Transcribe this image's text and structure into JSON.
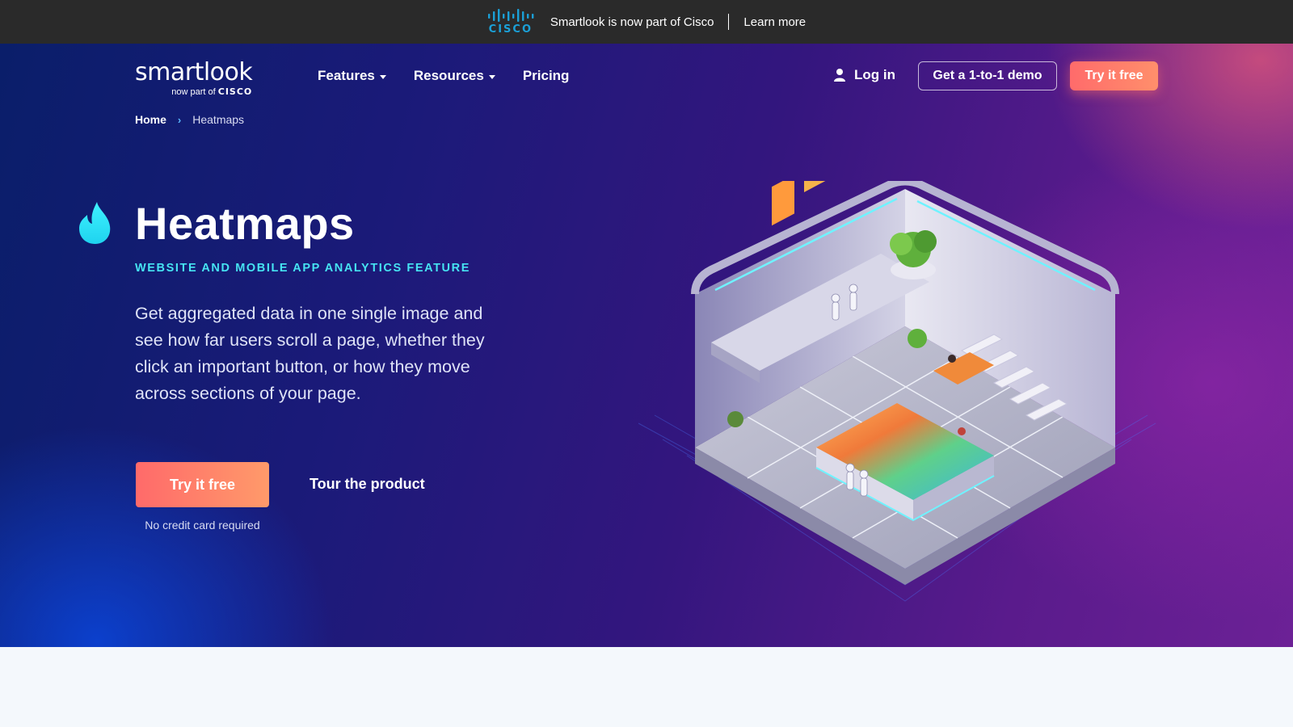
{
  "banner": {
    "logo_text": "CISCO",
    "message": "Smartlook is now part of Cisco",
    "link": "Learn more"
  },
  "nav": {
    "brand_name": "smartlook",
    "brand_sub_prefix": "now part of",
    "brand_sub_company": "CISCO",
    "menu": {
      "features": "Features",
      "resources": "Resources",
      "pricing": "Pricing"
    },
    "login": "Log in",
    "demo": "Get a 1-to-1 demo",
    "try_free": "Try it free"
  },
  "breadcrumb": {
    "home": "Home",
    "current": "Heatmaps"
  },
  "hero": {
    "title": "Heatmaps",
    "subtitle": "WEBSITE AND MOBILE APP ANALYTICS FEATURE",
    "description": "Get aggregated data in one single image and see how far users scroll a page, whether they click an important button, or how they move across sections of your page.",
    "cta_primary": "Try it free",
    "cta_secondary": "Tour the product",
    "note": "No credit card required"
  },
  "colors": {
    "accent_cyan": "#46e3f2",
    "cta_gradient_start": "#ff6a6a",
    "cta_gradient_end": "#ff9a6a",
    "cisco_blue": "#1ba0d7"
  }
}
